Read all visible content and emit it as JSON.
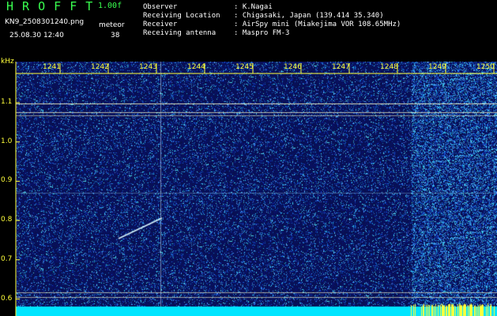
{
  "app_title": "H R O F F T",
  "version": "1.00f",
  "filename": "KN9_2508301240.png",
  "timestamp": "25.08.30 12:40",
  "meteor_label": "meteor",
  "meteor_count": "38",
  "info": {
    "labels": [
      "Observer",
      "Receiving Location",
      "Receiver",
      "Receiving antenna"
    ],
    "values": [
      ": K.Nagai",
      ": Chigasaki, Japan (139.414 35.340)",
      ": AirSpy mini (Miakejima VOR 108.65MHz)",
      ": Maspro FM-3"
    ]
  },
  "axis": {
    "y_unit": "kHz",
    "y_ticks": [
      "1.1",
      "1.0",
      "0.9",
      "0.8",
      "0.7",
      "0.6"
    ],
    "x_ticks": [
      "1241",
      "1242",
      "1243",
      "1244",
      "1245",
      "1246",
      "1247",
      "1248",
      "1249",
      "1250"
    ]
  },
  "colors": {
    "background": "#000000",
    "title_green": "#39ff4f",
    "axis_yellow": "#ffff3a",
    "waterfall_base": "#08124a",
    "carrier_line": "#ffffcc",
    "noise_band": "#00e5ff"
  }
}
